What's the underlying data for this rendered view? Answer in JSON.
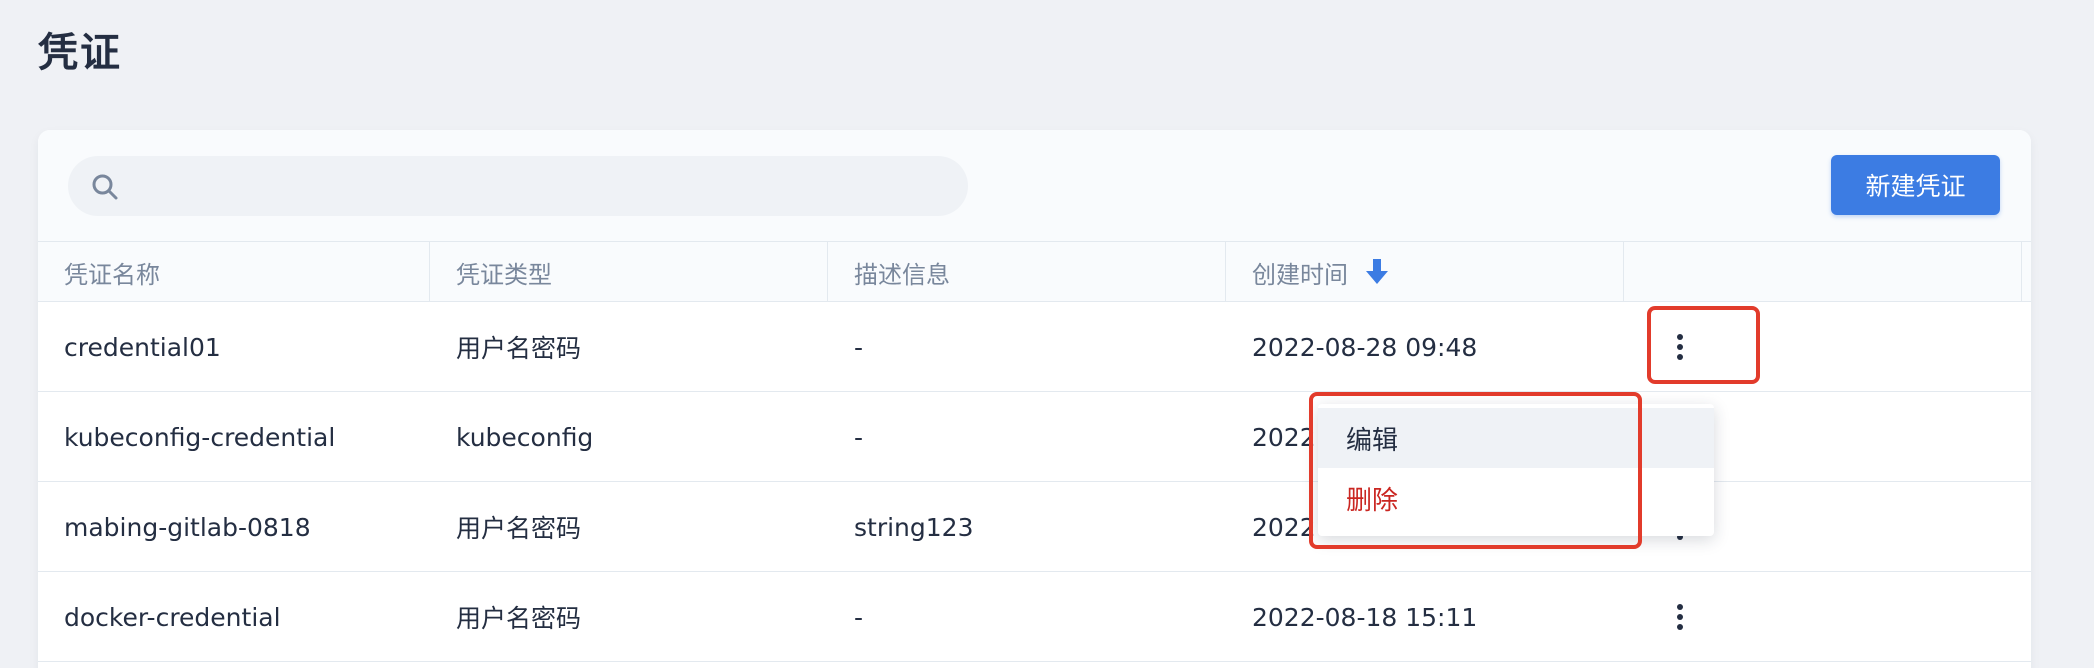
{
  "page": {
    "title": "凭证"
  },
  "search": {
    "placeholder": "",
    "value": ""
  },
  "toolbar": {
    "create_label": "新建凭证"
  },
  "table": {
    "columns": [
      "凭证名称",
      "凭证类型",
      "描述信息",
      "创建时间"
    ],
    "sort_column": "创建时间",
    "sort_direction": "descending",
    "rows": [
      {
        "name": "credential01",
        "type": "用户名密码",
        "description": "-",
        "created": "2022-08-28 09:48"
      },
      {
        "name": "kubeconfig-credential",
        "type": "kubeconfig",
        "description": "-",
        "created": "2022"
      },
      {
        "name": "mabing-gitlab-0818",
        "type": "用户名密码",
        "description": "string123",
        "created": "2022"
      },
      {
        "name": "docker-credential",
        "type": "用户名密码",
        "description": "-",
        "created": "2022-08-18 15:11"
      }
    ]
  },
  "menu": {
    "edit_label": "编辑",
    "delete_label": "删除"
  },
  "colors": {
    "accent": "#3c7ce3",
    "danger": "#ca2621",
    "highlight": "#e23b2b",
    "text": "#242e42",
    "muted": "#79879c"
  }
}
